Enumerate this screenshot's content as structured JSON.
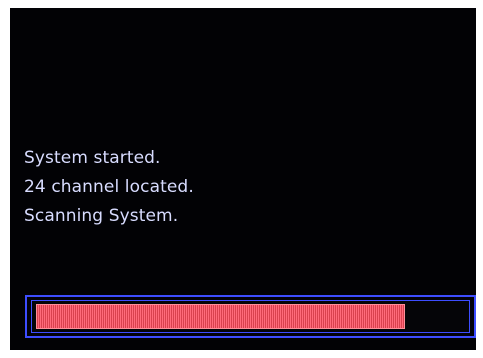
{
  "messages": {
    "line1": "System started.",
    "line2": "24 channel located.",
    "line3": "Scanning System."
  },
  "progress": {
    "value_fraction": 0.86,
    "fill_color": "#ff6b7b",
    "border_color": "#3d4dff"
  },
  "colors": {
    "background": "#020205",
    "text": "#d8dcff"
  }
}
